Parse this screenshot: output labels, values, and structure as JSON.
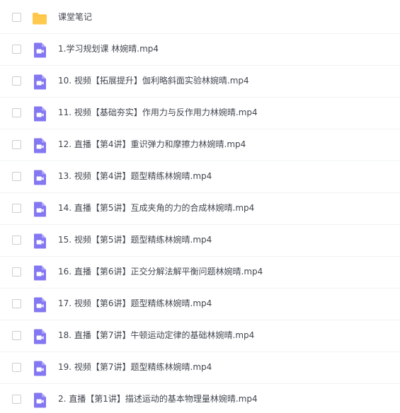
{
  "colors": {
    "folder": "#ffc94d",
    "video": "#8477f2",
    "text": "#41464f",
    "divider": "#f1f2f4"
  },
  "files": [
    {
      "type": "folder",
      "icon": "folder-icon",
      "name": "课堂笔记"
    },
    {
      "type": "video",
      "icon": "video-file-icon",
      "name": "1.学习规划课 林婉晴.mp4"
    },
    {
      "type": "video",
      "icon": "video-file-icon",
      "name": "10. 视频【拓展提升】伽利略斜面实验林婉晴.mp4"
    },
    {
      "type": "video",
      "icon": "video-file-icon",
      "name": "11. 视频【基础夯实】作用力与反作用力林婉晴.mp4"
    },
    {
      "type": "video",
      "icon": "video-file-icon",
      "name": "12. 直播【第4讲】重识弹力和摩擦力林婉晴.mp4"
    },
    {
      "type": "video",
      "icon": "video-file-icon",
      "name": "13. 视频【第4讲】题型精练林婉晴.mp4"
    },
    {
      "type": "video",
      "icon": "video-file-icon",
      "name": "14. 直播【第5讲】互成夹角的力的合成林婉晴.mp4"
    },
    {
      "type": "video",
      "icon": "video-file-icon",
      "name": "15. 视频【第5讲】题型精练林婉晴.mp4"
    },
    {
      "type": "video",
      "icon": "video-file-icon",
      "name": "16. 直播【第6讲】正交分解法解平衡问题林婉晴.mp4"
    },
    {
      "type": "video",
      "icon": "video-file-icon",
      "name": "17. 视频【第6讲】题型精练林婉晴.mp4"
    },
    {
      "type": "video",
      "icon": "video-file-icon",
      "name": "18. 直播【第7讲】牛顿运动定律的基础林婉晴.mp4"
    },
    {
      "type": "video",
      "icon": "video-file-icon",
      "name": "19. 视频【第7讲】题型精练林婉晴.mp4"
    },
    {
      "type": "video",
      "icon": "video-file-icon",
      "name": "2. 直播【第1讲】描述运动的基本物理量林婉晴.mp4"
    }
  ]
}
